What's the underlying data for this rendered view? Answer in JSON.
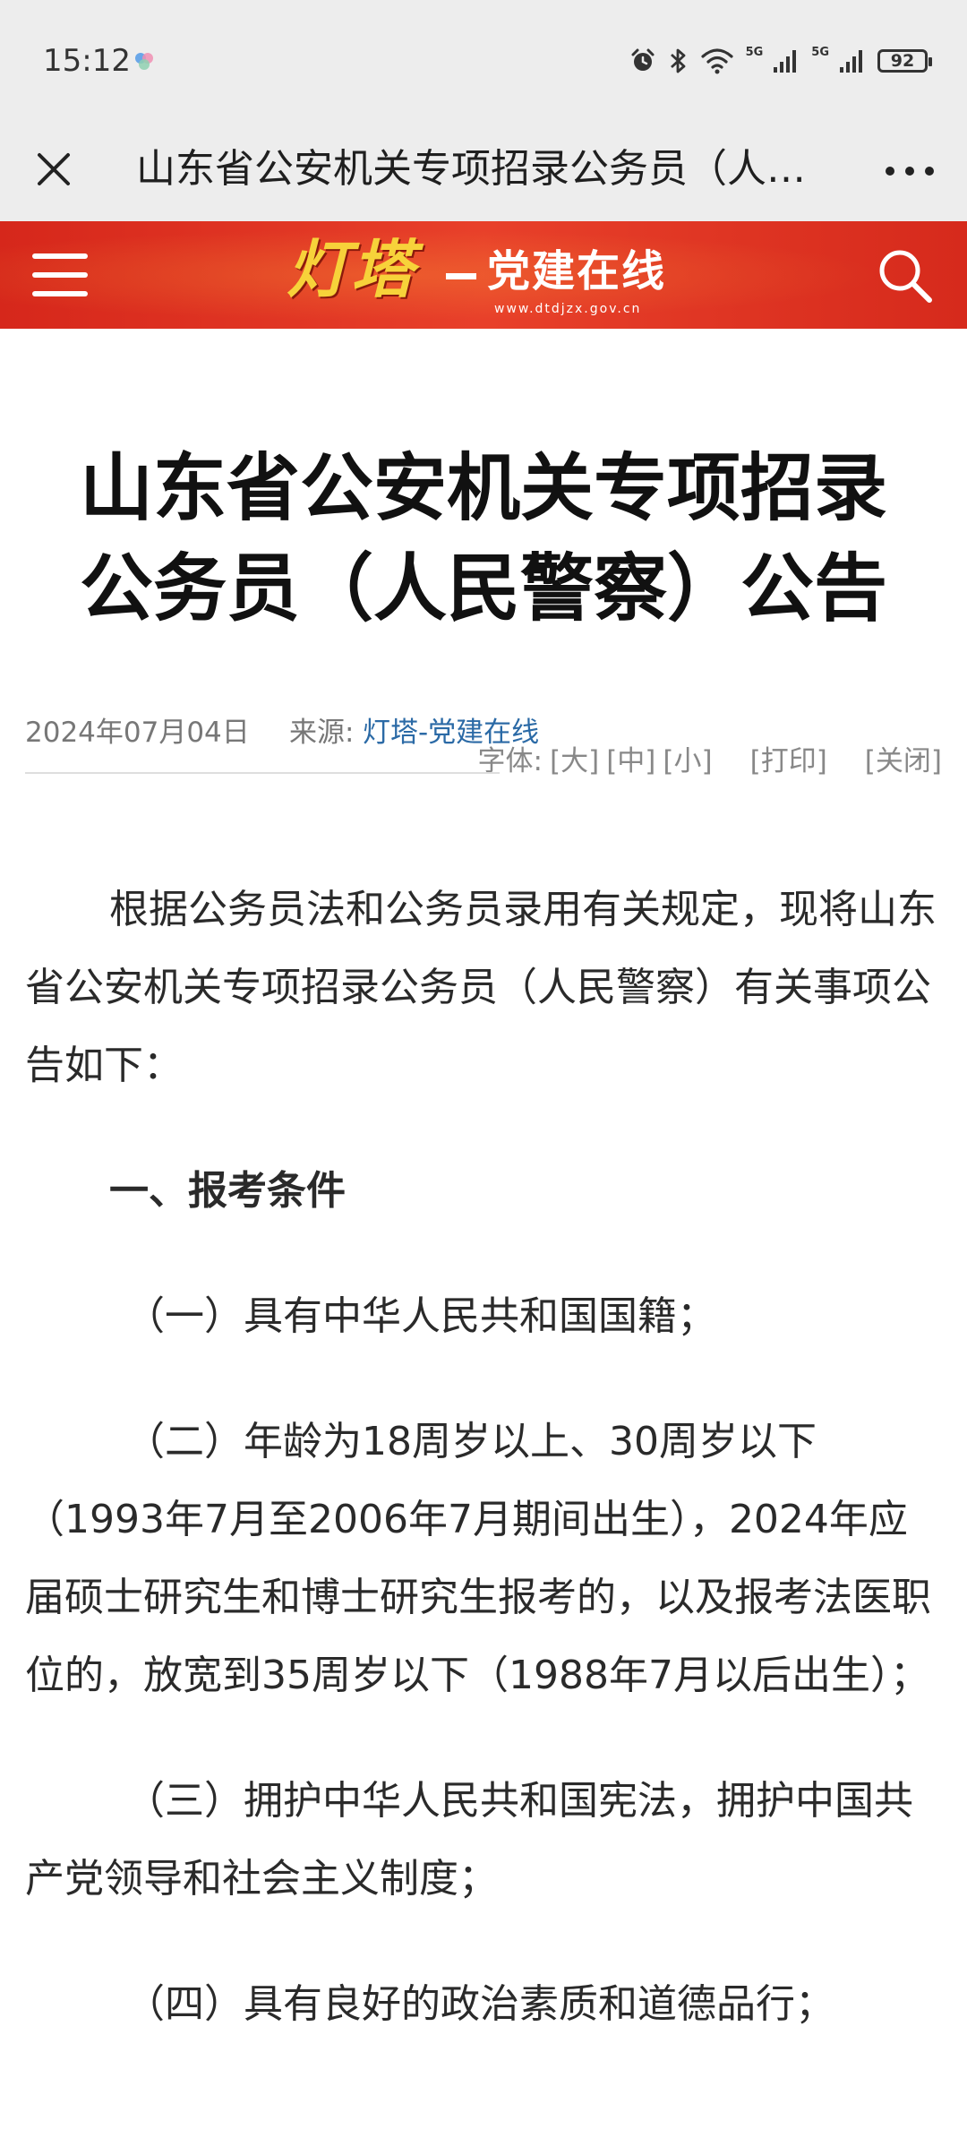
{
  "status_bar": {
    "time": "15:12",
    "battery": "92",
    "network_1": "5G",
    "network_2": "5G",
    "icons": [
      "app-icon",
      "alarm-icon",
      "bluetooth-icon",
      "wifi-icon",
      "signal-icon",
      "signal-icon",
      "battery-icon"
    ]
  },
  "browser": {
    "title": "山东省公安机关专项招录公务员（人民警察）公告",
    "close_icon": "close-icon",
    "more_icon": "more-icon"
  },
  "site_header": {
    "logo_main": "灯塔",
    "logo_sub": "党建在线",
    "logo_url": "www.dtdjzx.gov.cn",
    "menu_icon": "menu-icon",
    "search_icon": "search-icon",
    "colors": {
      "header_red": "#d6271b",
      "logo_gold": "#f7d23a"
    }
  },
  "article": {
    "title_line1": "山东省公安机关专项招录",
    "title_line2": "公务员（人民警察）公告",
    "date": "2024年07月04日",
    "source_label": "来源:",
    "source_name": "灯塔-党建在线",
    "font_label": "字体:",
    "font_large": "[大]",
    "font_medium": "[中]",
    "font_small": "[小]",
    "print": "[打印]",
    "close": "[关闭]",
    "paragraphs": {
      "intro": "根据公务员法和公务员录用有关规定，现将山东省公安机关专项招录公务员（人民警察）有关事项公告如下：",
      "section1": "一、报考条件",
      "item1": "（一）具有中华人民共和国国籍；",
      "item2": "（二）年龄为18周岁以上、30周岁以下（1993年7月至2006年7月期间出生），2024年应届硕士研究生和博士研究生报考的，以及报考法医职位的，放宽到35周岁以下（1988年7月以后出生）；",
      "item3": "（三）拥护中华人民共和国宪法，拥护中国共产党领导和社会主义制度；",
      "item4": "（四）具有良好的政治素质和道德品行；"
    },
    "link_color": "#2b6aa6"
  }
}
